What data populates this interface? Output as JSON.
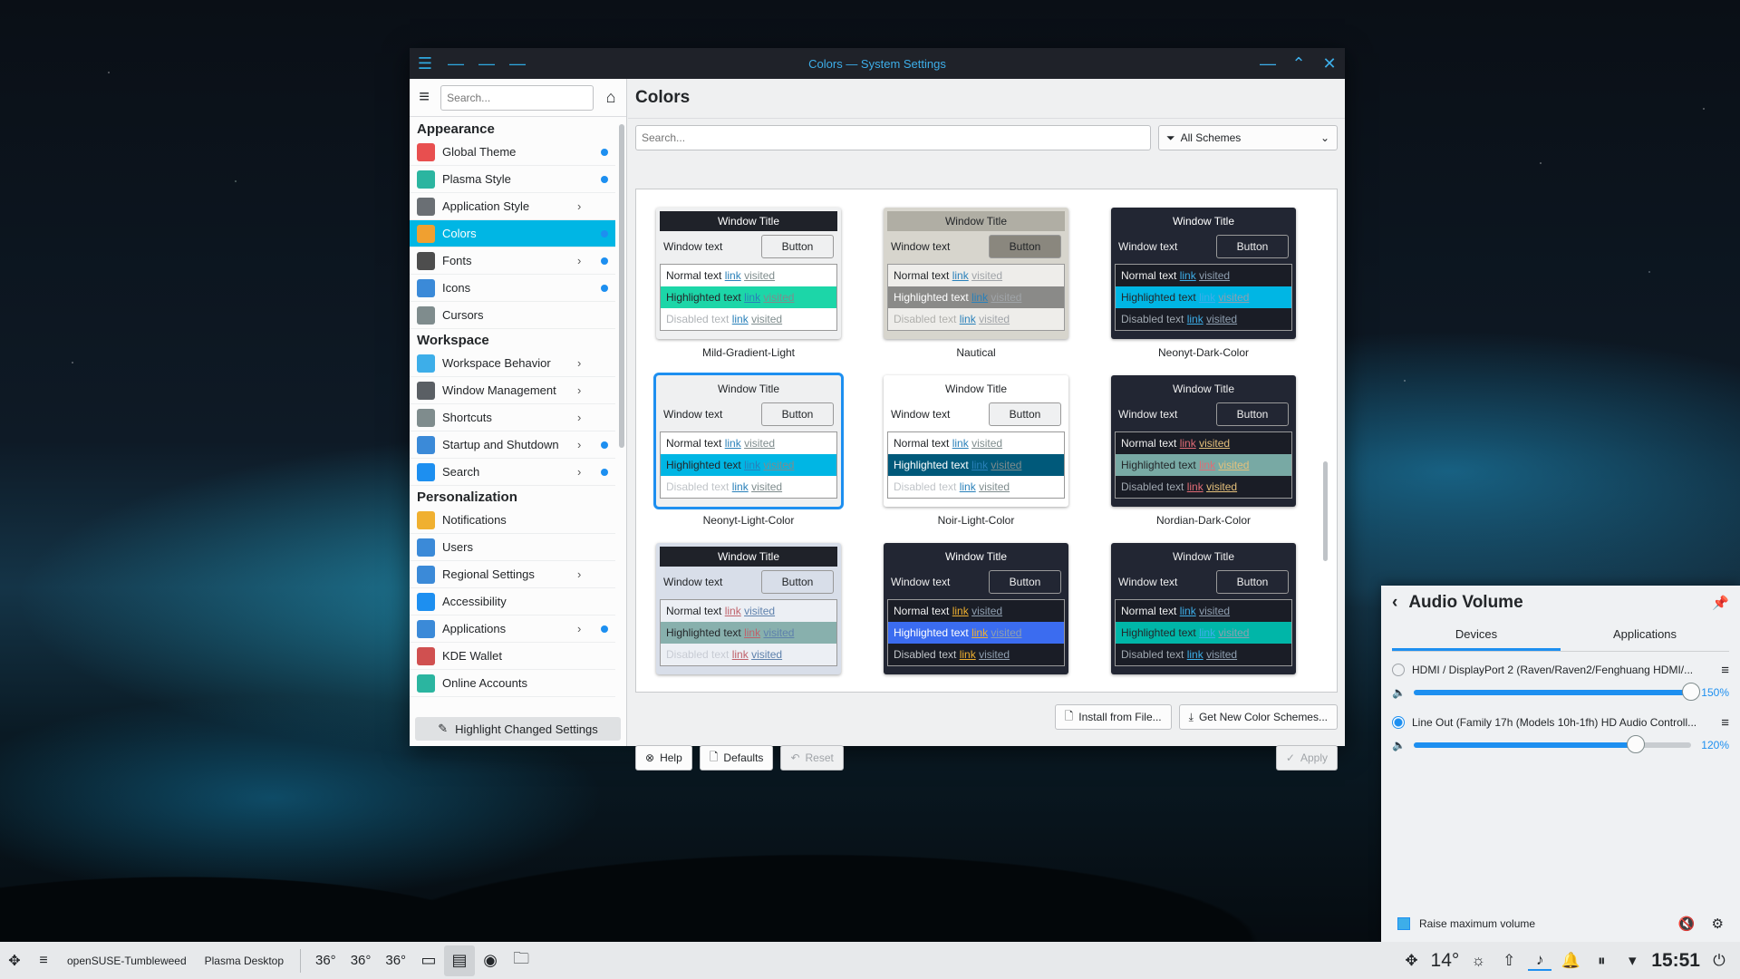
{
  "window": {
    "title": "Colors — System Settings"
  },
  "sidebar": {
    "search_placeholder": "Search...",
    "sections": [
      {
        "title": "Appearance",
        "items": [
          {
            "label": "Global Theme",
            "icon": "global-theme-icon",
            "color": "#e84f4f",
            "chevron": false,
            "dot": true,
            "selected": false
          },
          {
            "label": "Plasma Style",
            "icon": "plasma-style-icon",
            "color": "#2bb5a0",
            "chevron": false,
            "dot": true,
            "selected": false
          },
          {
            "label": "Application Style",
            "icon": "application-style-icon",
            "color": "#6a6f74",
            "chevron": true,
            "dot": false,
            "selected": false
          },
          {
            "label": "Colors",
            "icon": "colors-icon",
            "color": "#f0a030",
            "chevron": false,
            "dot": true,
            "selected": true
          },
          {
            "label": "Fonts",
            "icon": "fonts-icon",
            "color": "#4d4d4d",
            "chevron": true,
            "dot": true,
            "selected": false
          },
          {
            "label": "Icons",
            "icon": "icons-icon",
            "color": "#3b8ad8",
            "chevron": false,
            "dot": true,
            "selected": false
          },
          {
            "label": "Cursors",
            "icon": "cursors-icon",
            "color": "#7f8c8d",
            "chevron": false,
            "dot": false,
            "selected": false
          }
        ]
      },
      {
        "title": "Workspace",
        "items": [
          {
            "label": "Workspace Behavior",
            "icon": "workspace-behavior-icon",
            "color": "#3daee9",
            "chevron": true,
            "dot": false,
            "selected": false
          },
          {
            "label": "Window Management",
            "icon": "window-management-icon",
            "color": "#5a5f64",
            "chevron": true,
            "dot": false,
            "selected": false
          },
          {
            "label": "Shortcuts",
            "icon": "shortcuts-icon",
            "color": "#7f8c8d",
            "chevron": true,
            "dot": false,
            "selected": false
          },
          {
            "label": "Startup and Shutdown",
            "icon": "startup-shutdown-icon",
            "color": "#3b8ad8",
            "chevron": true,
            "dot": true,
            "selected": false
          },
          {
            "label": "Search",
            "icon": "search-settings-icon",
            "color": "#1d8ff0",
            "chevron": true,
            "dot": true,
            "selected": false
          }
        ]
      },
      {
        "title": "Personalization",
        "items": [
          {
            "label": "Notifications",
            "icon": "notifications-icon",
            "color": "#f0b030",
            "chevron": false,
            "dot": false,
            "selected": false
          },
          {
            "label": "Users",
            "icon": "users-icon",
            "color": "#3b8ad8",
            "chevron": false,
            "dot": false,
            "selected": false
          },
          {
            "label": "Regional Settings",
            "icon": "regional-settings-icon",
            "color": "#3b8ad8",
            "chevron": true,
            "dot": false,
            "selected": false
          },
          {
            "label": "Accessibility",
            "icon": "accessibility-icon",
            "color": "#1d8ff0",
            "chevron": false,
            "dot": false,
            "selected": false
          },
          {
            "label": "Applications",
            "icon": "applications-icon",
            "color": "#3b8ad8",
            "chevron": true,
            "dot": true,
            "selected": false
          },
          {
            "label": "KDE Wallet",
            "icon": "kde-wallet-icon",
            "color": "#d05050",
            "chevron": false,
            "dot": false,
            "selected": false
          },
          {
            "label": "Online Accounts",
            "icon": "online-accounts-icon",
            "color": "#2bb5a0",
            "chevron": false,
            "dot": false,
            "selected": false
          }
        ]
      }
    ],
    "highlight_button": "Highlight Changed Settings"
  },
  "main": {
    "title": "Colors",
    "search_placeholder": "Search...",
    "filter_label": "All Schemes",
    "schemes": [
      {
        "name": "Mild-Gradient-Light",
        "focus": false,
        "title_bg": "#1f2229",
        "title_fg": "#ffffff",
        "win_bg": "#eff0f1",
        "win_fg": "#232629",
        "btn_bg": "#eff0f1",
        "btn_fg": "#232629",
        "view_bg": "#ffffff",
        "view_fg": "#232629",
        "hl_bg": "#1cd6a8",
        "hl_fg": "#232629",
        "link": "#2980b9",
        "visited": "#7f8c8d",
        "dis": "#b0b4b8"
      },
      {
        "name": "Nautical",
        "focus": false,
        "title_bg": "#b0aea4",
        "title_fg": "#232629",
        "win_bg": "#d7d5cd",
        "win_fg": "#232629",
        "btn_bg": "#8a877e",
        "btn_fg": "#232629",
        "view_bg": "#eeedea",
        "view_fg": "#232629",
        "hl_bg": "#8a8a88",
        "hl_fg": "#ffffff",
        "link": "#2980b9",
        "visited": "#a0a4a8",
        "dis": "#b0b0ad"
      },
      {
        "name": "Neonyt-Dark-Color",
        "focus": false,
        "title_bg": "#222633",
        "title_fg": "#ffffff",
        "win_bg": "#222633",
        "win_fg": "#eeeeee",
        "btn_bg": "#222633",
        "btn_fg": "#eeeeee",
        "view_bg": "#1a1d26",
        "view_fg": "#eeeeee",
        "hl_bg": "#00b6e4",
        "hl_fg": "#232629",
        "link": "#3daee9",
        "visited": "#8f9fb0",
        "dis": "#a0a8b0"
      },
      {
        "name": "Neonyt-Light-Color",
        "focus": true,
        "title_bg": "#eff0f1",
        "title_fg": "#232629",
        "win_bg": "#eff0f1",
        "win_fg": "#232629",
        "btn_bg": "#eff0f1",
        "btn_fg": "#232629",
        "view_bg": "#ffffff",
        "view_fg": "#232629",
        "hl_bg": "#00b6e4",
        "hl_fg": "#232629",
        "link": "#2980b9",
        "visited": "#7f8c8d",
        "dis": "#c0c4c8"
      },
      {
        "name": "Noir-Light-Color",
        "focus": false,
        "title_bg": "#ffffff",
        "title_fg": "#232629",
        "win_bg": "#ffffff",
        "win_fg": "#232629",
        "btn_bg": "#eff0f1",
        "btn_fg": "#232629",
        "view_bg": "#ffffff",
        "view_fg": "#232629",
        "hl_bg": "#00597a",
        "hl_fg": "#ffffff",
        "link": "#2980b9",
        "visited": "#7f8c8d",
        "dis": "#c0c4c8"
      },
      {
        "name": "Nordian-Dark-Color",
        "focus": false,
        "title_bg": "#222633",
        "title_fg": "#eeeeee",
        "win_bg": "#222633",
        "win_fg": "#eeeeee",
        "btn_bg": "#222633",
        "btn_fg": "#eeeeee",
        "view_bg": "#1a1d26",
        "view_fg": "#eeeeee",
        "hl_bg": "#78a9a4",
        "hl_fg": "#232629",
        "link": "#e06c75",
        "visited": "#e5c07b",
        "dis": "#a0a8b0"
      },
      {
        "name": "",
        "focus": false,
        "title_bg": "#1f2229",
        "title_fg": "#ffffff",
        "win_bg": "#d8dee9",
        "win_fg": "#232629",
        "btn_bg": "#d8dee9",
        "btn_fg": "#232629",
        "view_bg": "#eceff4",
        "view_fg": "#232629",
        "hl_bg": "#88b0ad",
        "hl_fg": "#232629",
        "link": "#bf616a",
        "visited": "#5e81ac",
        "dis": "#c8ccd4"
      },
      {
        "name": "",
        "focus": false,
        "title_bg": "#222633",
        "title_fg": "#ffffff",
        "win_bg": "#222633",
        "win_fg": "#eeeeee",
        "btn_bg": "#222633",
        "btn_fg": "#eeeeee",
        "view_bg": "#1a1d26",
        "view_fg": "#eeeeee",
        "hl_bg": "#3b6cf0",
        "hl_fg": "#ffffff",
        "link": "#f0b030",
        "visited": "#8f9fb0",
        "dis": "#c0c4c8"
      },
      {
        "name": "",
        "focus": false,
        "title_bg": "#222633",
        "title_fg": "#eeeeee",
        "win_bg": "#222633",
        "win_fg": "#eeeeee",
        "btn_bg": "#222633",
        "btn_fg": "#eeeeee",
        "view_bg": "#1a1d26",
        "view_fg": "#eeeeee",
        "hl_bg": "#00b6a8",
        "hl_fg": "#232629",
        "link": "#3daee9",
        "visited": "#8f9fb0",
        "dis": "#a0a8b0"
      }
    ],
    "card_text": {
      "window_title": "Window Title",
      "window_text": "Window text",
      "button": "Button",
      "normal": "Normal text",
      "highlighted": "Highlighted text",
      "disabled": "Disabled text",
      "link": "link",
      "visited": "visited"
    },
    "install_button": "Install from File...",
    "get_new_button": "Get New Color Schemes...",
    "help_button": "Help",
    "defaults_button": "Defaults",
    "reset_button": "Reset",
    "apply_button": "Apply"
  },
  "audio": {
    "title": "Audio Volume",
    "tabs": [
      "Devices",
      "Applications"
    ],
    "devices": [
      {
        "name": "HDMI / DisplayPort 2 (Raven/Raven2/Fenghuang HDMI/...",
        "level_pct": 150,
        "level_label": "150%",
        "selected": false
      },
      {
        "name": "Line Out (Family 17h (Models 10h-1fh) HD Audio Controll...",
        "level_pct": 120,
        "level_label": "120%",
        "selected": true
      }
    ],
    "raise_max": "Raise maximum volume"
  },
  "taskbar": {
    "host": "openSUSE-Tumbleweed",
    "desktop": "Plasma Desktop",
    "temps": [
      "36°",
      "36°",
      "36°"
    ],
    "weather": "14°",
    "clock": "15:51"
  },
  "colors": {
    "accent": "#1d8ff0",
    "selection": "#00b6e4"
  }
}
